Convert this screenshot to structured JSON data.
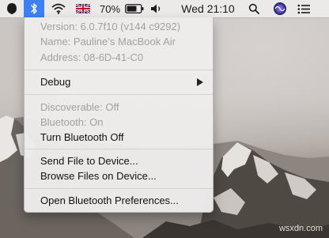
{
  "menubar": {
    "battery_percent": "70%",
    "clock": "Wed 21:10",
    "icons": [
      "dark-circle-icon",
      "bluetooth-icon",
      "wifi-icon",
      "uk-flag-icon",
      "battery-icon",
      "volume-icon",
      "search-icon",
      "siri-icon",
      "notification-center-icon"
    ]
  },
  "bluetooth_menu": {
    "info": {
      "version": "Version: 6.0.7f10 (v144 c9292)",
      "name": "Name: Pauline’s MacBook Air",
      "address": "Address: 08-6D-41-C0"
    },
    "debug_label": "Debug",
    "status": {
      "discoverable": "Discoverable: Off",
      "bluetooth": "Bluetooth: On",
      "turn_off": "Turn Bluetooth Off"
    },
    "actions": {
      "send_file": "Send File to Device...",
      "browse_files": "Browse Files on Device..."
    },
    "preferences": "Open Bluetooth Preferences..."
  },
  "watermark": "wsxdn.com",
  "colors": {
    "highlight": "#3c80f3",
    "menu_bg": "#edeceb",
    "disabled_text": "#a3a19f"
  }
}
